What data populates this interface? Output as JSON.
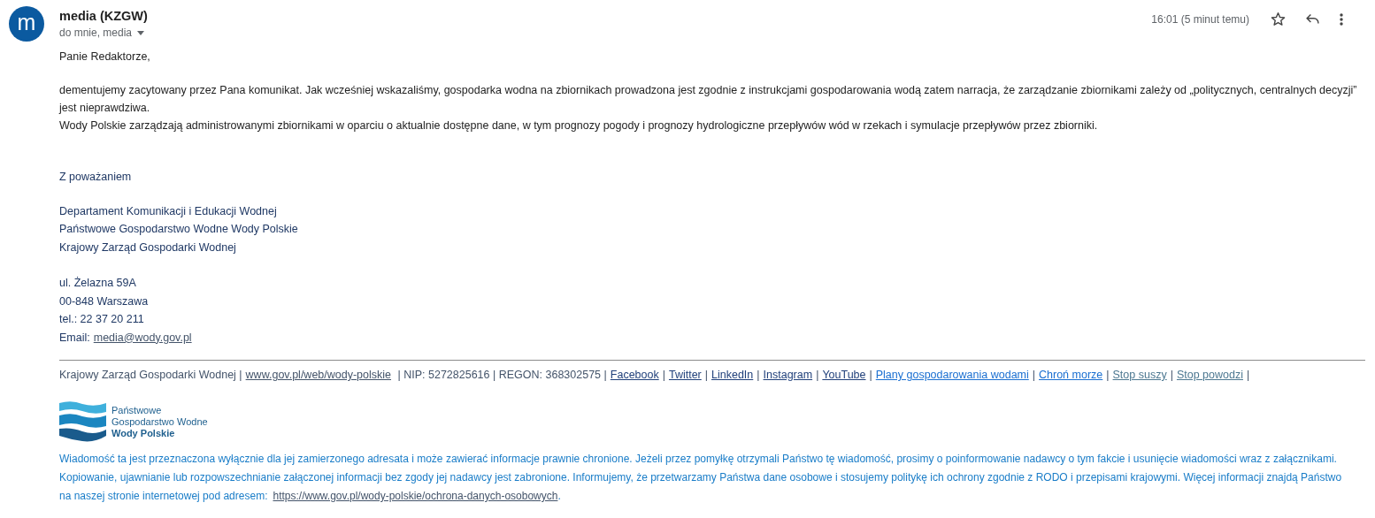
{
  "sender": {
    "avatar_letter": "m",
    "name": "media (KZGW)",
    "recipients": "do mnie, media"
  },
  "time": "16:01 (5 minut temu)",
  "starred": false,
  "body": {
    "greeting": "Panie Redaktorze,",
    "paragraphs": [
      "dementujemy zacytowany przez Pana komunikat. Jak wcześniej wskazaliśmy, gospodarka wodna na zbiornikach prowadzona jest zgodnie z instrukcjami gospodarowania wodą zatem narracja, że zarządzanie zbiornikami zależy od „politycznych, centralnych decyzji” jest nieprawdziwa.",
      "Wody Polskie zarządzają administrowanymi zbiornikami w oparciu o aktualnie dostępne dane, w tym prognozy pogody i prognozy hydrologiczne przepływów wód w rzekach i symulacje przepływów przez zbiorniki."
    ]
  },
  "signature": {
    "closing": "Z poważaniem",
    "organization": [
      "Departament Komunikacji i Edukacji Wodnej",
      "Państwowe Gospodarstwo Wodne Wody Polskie",
      "Krajowy Zarząd Gospodarki Wodnej"
    ],
    "address": [
      "ul. Żelazna 59A",
      "00-848 Warszawa",
      "tel.: 22 37 20 211"
    ],
    "email_label": "Email:",
    "email": "media@wody.gov.pl"
  },
  "footer": [
    {
      "kind": "text",
      "text": "Krajowy Zarząd Gospodarki Wodnej |"
    },
    {
      "kind": "link",
      "text": "www.gov.pl/web/wody-polskie",
      "color": "#44546a"
    },
    {
      "kind": "text",
      "text": " | NIP: 5272825616 | REGON: 368302575 |"
    },
    {
      "kind": "link",
      "text": "Facebook",
      "color": "#1f3f7a"
    },
    {
      "kind": "text",
      "text": "|"
    },
    {
      "kind": "link",
      "text": "Twitter",
      "color": "#1f3f7a"
    },
    {
      "kind": "text",
      "text": "|"
    },
    {
      "kind": "link",
      "text": "LinkedIn",
      "color": "#1f3f7a"
    },
    {
      "kind": "text",
      "text": "|"
    },
    {
      "kind": "link",
      "text": "Instagram",
      "color": "#1f3f7a"
    },
    {
      "kind": "text",
      "text": "|"
    },
    {
      "kind": "link",
      "text": "YouTube",
      "color": "#1f3f7a"
    },
    {
      "kind": "text",
      "text": "|"
    },
    {
      "kind": "link",
      "text": "Plany gospodarowania wodami",
      "color": "#1a6fd1"
    },
    {
      "kind": "text",
      "text": "|"
    },
    {
      "kind": "link",
      "text": "Chroń morze",
      "color": "#1a6fd1"
    },
    {
      "kind": "text",
      "text": "|"
    },
    {
      "kind": "link",
      "text": "Stop suszy",
      "color": "#4d7891"
    },
    {
      "kind": "text",
      "text": "|"
    },
    {
      "kind": "link",
      "text": "Stop powodzi",
      "color": "#4d7891"
    },
    {
      "kind": "text",
      "text": "|"
    }
  ],
  "logo": {
    "lines": [
      "Państwowe",
      "Gospodarstwo Wodne",
      "Wody Polskie"
    ]
  },
  "disclaimer": {
    "lines": [
      "Wiadomość ta jest przeznaczona wyłącznie dla jej zamierzonego adresata i może zawierać informacje prawnie chronione. Jeżeli przez pomyłkę otrzymali Państwo tę wiadomość, prosimy o poinformowanie nadawcy o tym fakcie i usunięcie wiadomości wraz z załącznikami.",
      "Kopiowanie, ujawnianie lub rozpowszechnianie załączonej informacji bez zgody jej nadawcy jest zabronione. Informujemy, że przetwarzamy Państwa dane osobowe i stosujemy politykę ich ochrony zgodnie z RODO i przepisami krajowymi. Więcej informacji znajdą Państwo"
    ],
    "last_prefix": "na naszej stronie internetowej pod adresem:",
    "link": "https://www.gov.pl/wody-polskie/ochrona-danych-osobowych",
    "last_suffix": "."
  }
}
